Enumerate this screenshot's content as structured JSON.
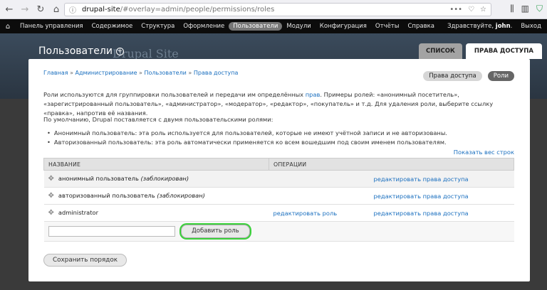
{
  "browser": {
    "url_host": "drupal-site",
    "url_path": "/#overlay=admin/people/permissions/roles"
  },
  "toolbar": {
    "items": [
      "Панель управления",
      "Содержимое",
      "Структура",
      "Оформление",
      "Пользователи",
      "Модули",
      "Конфигурация",
      "Отчёты",
      "Справка"
    ],
    "greeting": "Здравствуйте,",
    "username": "john",
    "logout": "Выход"
  },
  "header": {
    "title": "Пользователи",
    "site_name": "Drupal Site",
    "tabs": [
      "СПИСОК",
      "ПРАВА ДОСТУПА"
    ]
  },
  "breadcrumb": [
    "Главная",
    "Администрирование",
    "Пользователи",
    "Права доступа"
  ],
  "secondary_tabs": [
    "Права доступа",
    "Роли"
  ],
  "intro": {
    "p1_before": "Роли используются для группировки пользователей и передачи им определённых ",
    "p1_link": "прав",
    "p1_after": ". Примеры ролей: «анонимный посетитель», «зарегистрированный пользователь», «администратор», «модератор», «редактор», «покупатель» и т.д. Для удаления роли, выберите ссылку «правка», напротив её названия.",
    "p2": "По умолчанию, Drupal поставляется с двумя пользовательскими ролями:",
    "bullet1": "Анонимный пользователь: эта роль используется для пользователей, которые не имеют учётной записи и не авторизованы.",
    "bullet2": "Авторизованный пользователь: эта роль автоматически применяется ко всем вошедшим под своим именем пользователям."
  },
  "show_weights": "Показать вес строк",
  "table": {
    "col_name": "НАЗВАНИЕ",
    "col_ops": "ОПЕРАЦИИ",
    "rows": [
      {
        "name": "анонимный пользователь",
        "locked": "(заблокирован)",
        "edit_role": "",
        "edit_perms": "редактировать права доступа"
      },
      {
        "name": "авторизованный пользователь",
        "locked": "(заблокирован)",
        "edit_role": "",
        "edit_perms": "редактировать права доступа"
      },
      {
        "name": "administrator",
        "locked": "",
        "edit_role": "редактировать роль",
        "edit_perms": "редактировать права доступа"
      }
    ],
    "new_role_value": "",
    "add_button": "Добавить роль"
  },
  "save_button": "Сохранить порядок",
  "colors": {
    "link": "#1a6fbf",
    "highlight": "#3ad23a",
    "toolbar": "#0c0c0c"
  }
}
